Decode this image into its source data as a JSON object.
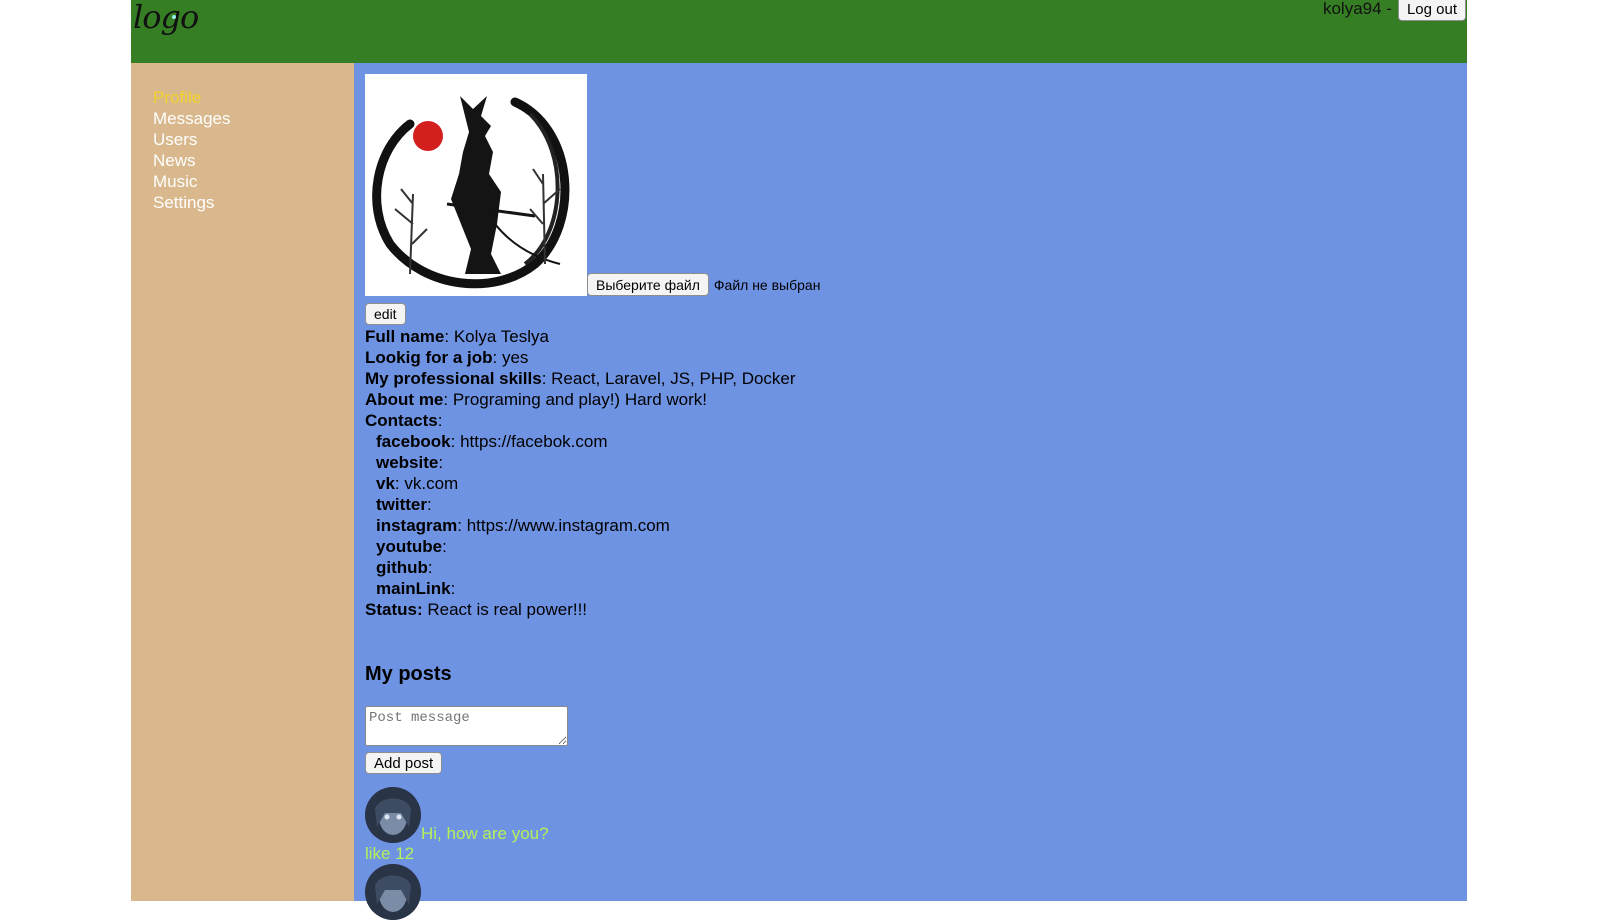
{
  "header": {
    "logo": "logo",
    "login_name": "kolya94 -",
    "logout_label": "Log out"
  },
  "sidebar": {
    "items": [
      {
        "label": "Profile",
        "active": true
      },
      {
        "label": "Messages"
      },
      {
        "label": "Users"
      },
      {
        "label": "News"
      },
      {
        "label": "Music"
      },
      {
        "label": "Settings"
      }
    ]
  },
  "profile": {
    "file_button": "Выберите файл",
    "file_status": "Файл не выбран",
    "edit_label": "edit",
    "full_name_label": "Full name",
    "full_name": "Kolya Teslya",
    "job_label": "Lookig for a job",
    "job": "yes",
    "skills_label": "My professional skills",
    "skills": "React, Laravel, JS, PHP, Docker",
    "about_label": "About me",
    "about": "Programing and play!) Hard work!",
    "contacts_label": "Contacts",
    "contacts": [
      {
        "name": "facebook",
        "value": "https://facebok.com"
      },
      {
        "name": "website",
        "value": ""
      },
      {
        "name": "vk",
        "value": "vk.com"
      },
      {
        "name": "twitter",
        "value": ""
      },
      {
        "name": "instagram",
        "value": "https://www.instagram.com"
      },
      {
        "name": "youtube",
        "value": ""
      },
      {
        "name": "github",
        "value": ""
      },
      {
        "name": "mainLink",
        "value": ""
      }
    ],
    "status_label": "Status:",
    "status": "React is real power!!!"
  },
  "posts": {
    "title": "My posts",
    "placeholder": "Post message",
    "add_label": "Add post",
    "items": [
      {
        "text": "Hi, how are you?",
        "likes": "like 12"
      }
    ]
  },
  "colors": {
    "header": "#367e23",
    "sidebar": "#d8b88c",
    "content": "#6f93e3",
    "active_nav": "#f3d22c",
    "post_text": "#b6f05a"
  }
}
